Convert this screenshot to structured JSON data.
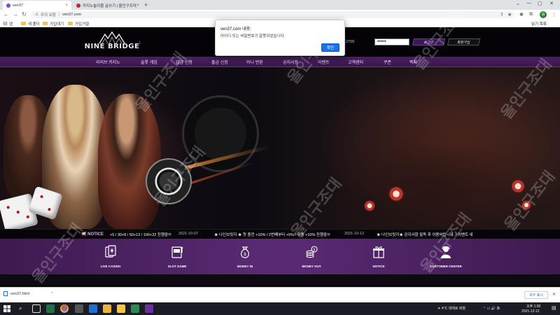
{
  "browser": {
    "tabs": [
      {
        "title": "ven37",
        "active": true
      },
      {
        "title": "카지노놀이블 글쓰기 | 올인구조대",
        "active": false
      }
    ],
    "new_tab": "+",
    "window_controls": {
      "minimize": "—",
      "maximize": "▢",
      "close": "✕"
    },
    "address": {
      "warning": "⚠",
      "security_label": "주의 요함",
      "separator": "|",
      "url": "ven37.com"
    },
    "profile_initial": "뭄",
    "bookmarks": [
      "앱",
      "새 폴더",
      "가입대기",
      "가입거절"
    ],
    "reading_list": "읽기 목록"
  },
  "site": {
    "logo_text": "NINE BRIDGE",
    "logo_badge": "1",
    "header_phone_fragment": "2700",
    "password_value": "••••••",
    "login_label": "로그인",
    "join_label": "회원가입",
    "nav": [
      "라이브 카지노",
      "슬롯 게임",
      "입금 신청",
      "출금 신청",
      "머니 변환",
      "공지사항",
      "이벤트",
      "고객센터",
      "쿠폰",
      "쪽지"
    ],
    "notice": {
      "label": "NOTICE",
      "items": [
        {
          "text": "+5 / 30+8 / 50+12 / 100+22 진행중!!!",
          "date": "2021-10-07"
        },
        {
          "text": "★ 나인브릿지 ★ 첫 충전 +10% / 2번째부터 +5% / 무충 +10% 진행중!!!",
          "date": "2021-10-12"
        },
        {
          "text": "★ 나인브릿지★ 공지사항 필독 후 이용바랍니다. / 이벤트 내",
          "date": ""
        }
      ]
    },
    "quick_menu": [
      "LIVE CASINO",
      "SLOT GAME",
      "MONEY IN",
      "MONEY OUT",
      "NOTICE",
      "CUSTOMER CENTER"
    ]
  },
  "dialog": {
    "title": "ven37.com 내용:",
    "message": "아이디 또는 비밀번호가 잘못되었습니다.",
    "ok_label": "확인"
  },
  "download": {
    "filename": "ven37.html",
    "show_all": "모두 표시",
    "close": "✕"
  },
  "taskbar": {
    "weather": "4°C 대체로 화창",
    "time": "오후 1:00",
    "date": "2021-12-12"
  },
  "watermark": "올인구조대",
  "colors": {
    "accent_purple": "#4b1f62",
    "dialog_ok": "#1a73e8",
    "notice_label": "#d7b5ff"
  }
}
